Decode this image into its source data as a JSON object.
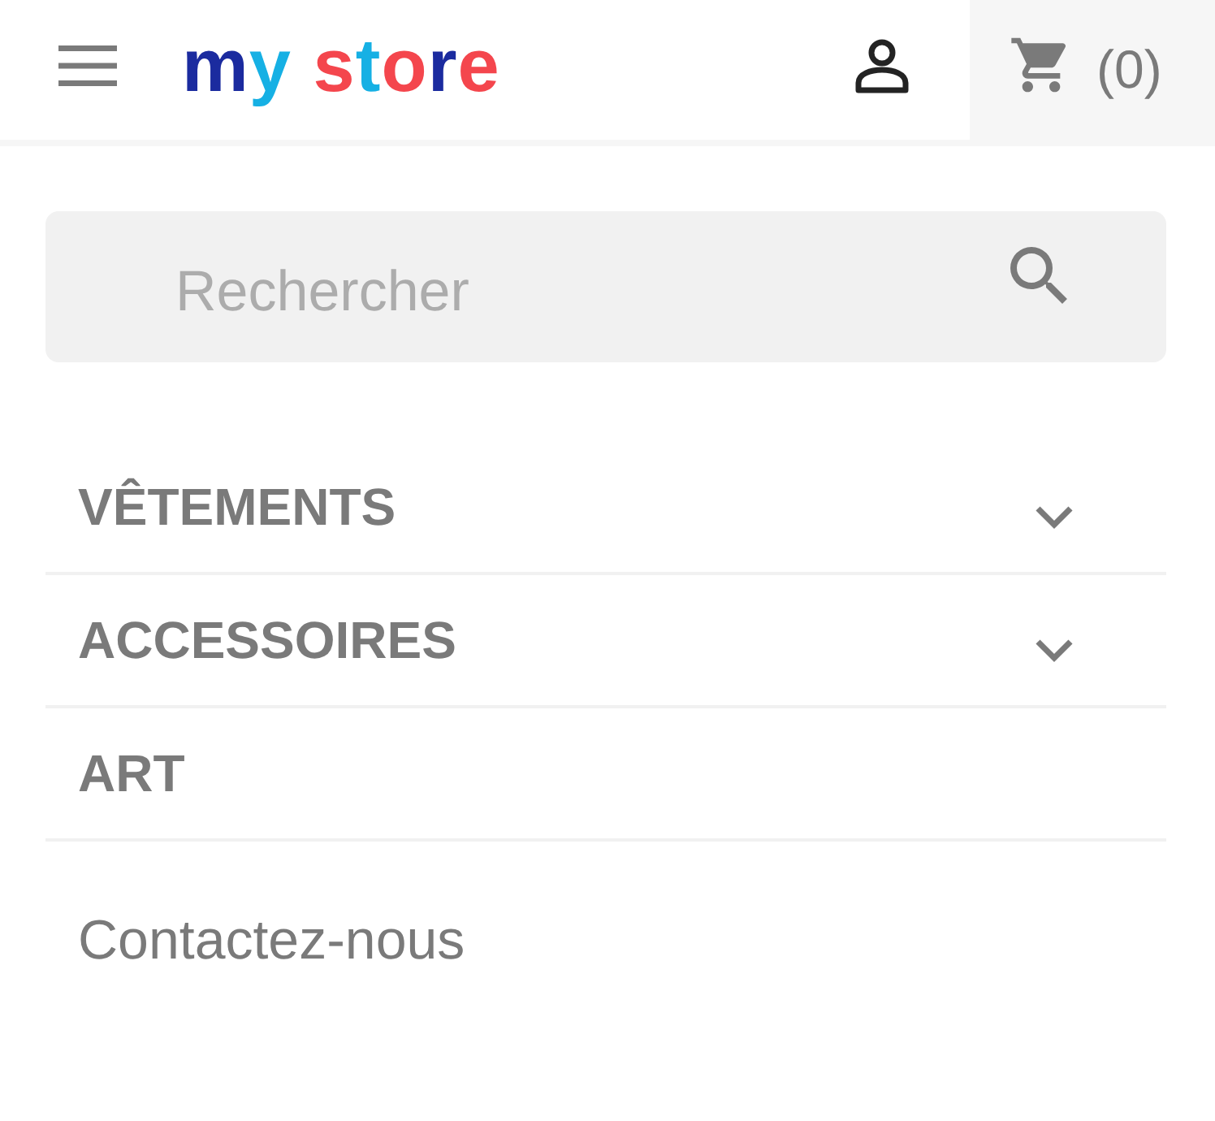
{
  "header": {
    "logo": "my store",
    "cart_count": "(0)"
  },
  "search": {
    "placeholder": "Rechercher"
  },
  "menu": [
    {
      "label": "VÊTEMENTS",
      "has_submenu": true
    },
    {
      "label": "ACCESSOIRES",
      "has_submenu": true
    },
    {
      "label": "ART",
      "has_submenu": false
    }
  ],
  "contact": "Contactez-nous"
}
